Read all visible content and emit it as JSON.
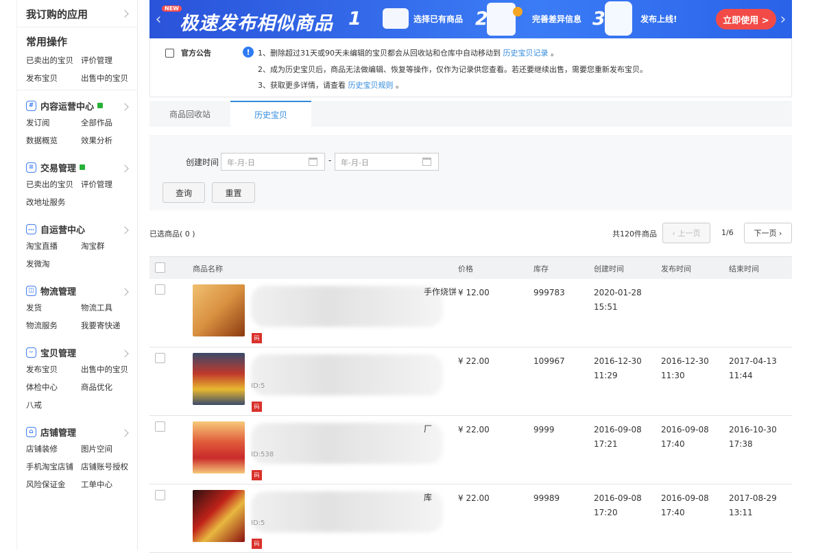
{
  "sidebar": {
    "top": "我订购的应用",
    "common": {
      "title": "常用操作",
      "links": [
        "已卖出的宝贝",
        "评价管理",
        "发布宝贝",
        "出售中的宝贝"
      ]
    },
    "sections": [
      {
        "title": "内容运营中心",
        "icon": "hash-icon",
        "flag": true,
        "links": [
          "发订阅",
          "全部作品",
          "数据概览",
          "效果分析"
        ]
      },
      {
        "title": "交易管理",
        "icon": "clipboard-icon",
        "flag": true,
        "links": [
          "已卖出的宝贝",
          "评价管理",
          "改地址服务"
        ]
      },
      {
        "title": "自运营中心",
        "icon": "chat-icon",
        "flag": false,
        "links": [
          "淘宝直播",
          "淘宝群",
          "发微淘"
        ]
      },
      {
        "title": "物流管理",
        "icon": "map-icon",
        "flag": false,
        "links": [
          "发货",
          "物流工具",
          "物流服务",
          "我要寄快递"
        ]
      },
      {
        "title": "宝贝管理",
        "icon": "bag-icon",
        "flag": false,
        "links": [
          "发布宝贝",
          "出售中的宝贝",
          "体检中心",
          "商品优化",
          "八戒"
        ]
      },
      {
        "title": "店铺管理",
        "icon": "store-icon",
        "flag": false,
        "links": [
          "店铺装修",
          "图片空间",
          "手机淘宝店铺",
          "店铺账号授权",
          "风险保证金",
          "工单中心"
        ]
      }
    ]
  },
  "banner": {
    "badge": "NEW",
    "title": "极速发布相似商品",
    "steps": [
      "选择已有商品",
      "完善差异信息",
      "发布上线!"
    ],
    "step_nums": [
      "1",
      "2",
      "3"
    ],
    "cta": "立即使用 >"
  },
  "notice": {
    "label": "官方公告",
    "lines": [
      {
        "text": "1、删除超过31天或90天未编辑的宝贝都会从回收站和仓库中自动移动到 ",
        "link": "历史宝贝记录",
        "tail": " 。"
      },
      {
        "text": "2、成为历史宝贝后，商品无法做编辑、恢复等操作，仅作为记录供您查看。若还要继续出售，需要您重新发布宝贝。",
        "link": "",
        "tail": ""
      },
      {
        "text": "3、获取更多详情，请查看 ",
        "link": "历史宝贝规则",
        "tail": " 。"
      }
    ]
  },
  "tabs": [
    "商品回收站",
    "历史宝贝"
  ],
  "filter": {
    "label": "创建时间",
    "start_placeholder": "年-月-日",
    "end_placeholder": "年-月-日",
    "dash": "-",
    "query": "查询",
    "reset": "重置"
  },
  "list": {
    "selected": "已选商品( 0 )",
    "total": "共120件商品",
    "prev": "上一页",
    "page": "1/6",
    "next": "下一页"
  },
  "table": {
    "headers": [
      "商品名称",
      "价格",
      "库存",
      "创建时间",
      "发布时间",
      "结束时间"
    ],
    "rows": [
      {
        "name_tail": "手作烧饼",
        "id": "",
        "price": "¥ 12.00",
        "stock": "999783",
        "created": "2020-01-28 15:51",
        "published": "",
        "ended": "",
        "qr": "码"
      },
      {
        "name_tail": "",
        "id": "ID:5",
        "price": "¥ 22.00",
        "stock": "109967",
        "created": "2016-12-30 11:29",
        "published": "2016-12-30 11:30",
        "ended": "2017-04-13 11:44",
        "qr": "码"
      },
      {
        "name_tail": "厂",
        "id": "ID:538",
        "price": "¥ 22.00",
        "stock": "9999",
        "created": "2016-09-08 17:21",
        "published": "2016-09-08 17:40",
        "ended": "2016-10-30 17:38",
        "qr": "码"
      },
      {
        "name_tail": "库",
        "id": "ID:5",
        "price": "¥ 22.00",
        "stock": "99989",
        "created": "2016-09-08 17:20",
        "published": "2016-09-08 17:40",
        "ended": "2017-08-29 13:11",
        "qr": "码"
      }
    ]
  },
  "colors": {
    "accent": "#3089dc",
    "banner": "#2a53d9",
    "cta": "#f24b47",
    "flag": "#27b03a"
  }
}
